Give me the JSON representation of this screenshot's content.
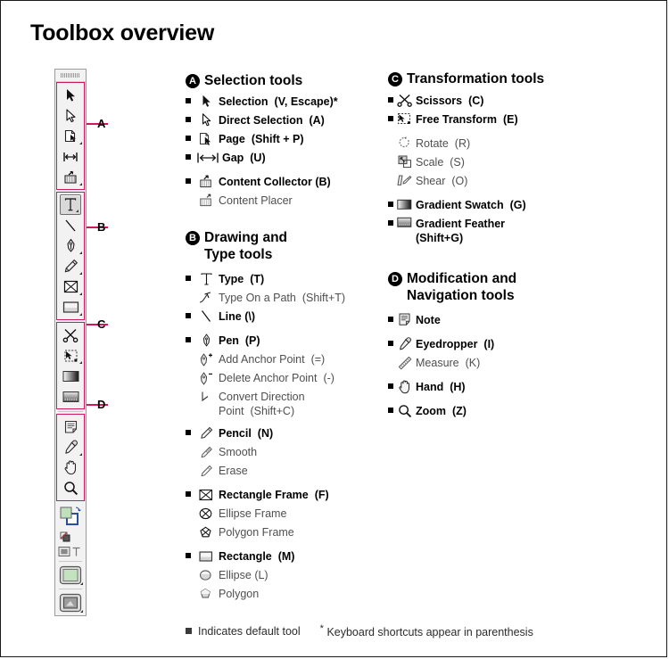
{
  "page": {
    "title": "Toolbox overview",
    "accent_color": "#d0165c",
    "dim_text_color": "#4f4f4f"
  },
  "callouts": [
    {
      "label": "A"
    },
    {
      "label": "B"
    },
    {
      "label": "C"
    },
    {
      "label": "D"
    }
  ],
  "toolbox": {
    "groups": [
      {
        "callout": "A",
        "highlighted": true,
        "tools": [
          "selection-tool",
          "direct-selection-tool",
          "page-tool",
          "gap-tool",
          "content-collector-tool"
        ]
      },
      {
        "callout": "B",
        "highlighted": true,
        "tools": [
          "type-tool",
          "line-tool",
          "pen-tool",
          "pencil-tool",
          "rectangle-frame-tool",
          "rectangle-tool"
        ]
      },
      {
        "callout": "C",
        "highlighted": true,
        "tools": [
          "scissors-tool",
          "free-transform-tool",
          "gradient-swatch-tool",
          "gradient-feather-tool"
        ]
      },
      {
        "callout": "D",
        "highlighted": true,
        "tools": [
          "note-tool",
          "eyedropper-tool",
          "hand-tool",
          "zoom-tool"
        ]
      },
      {
        "callout": "",
        "highlighted": false,
        "tools": [
          "fill-stroke-swatches",
          "formatting-affects-container",
          "normal-view-mode",
          "preview-mode"
        ]
      }
    ]
  },
  "sections": [
    {
      "badge": "A",
      "title": "Selection tools",
      "items": [
        {
          "icon": "selection-icon",
          "default": true,
          "name": "Selection",
          "shortcut": "(V, Escape)*"
        },
        {
          "icon": "direct-selection-icon",
          "default": true,
          "name": "Direct Selection",
          "shortcut": "(A)"
        },
        {
          "icon": "page-icon",
          "default": true,
          "name": "Page",
          "shortcut": "(Shift + P)"
        },
        {
          "icon": "gap-icon",
          "default": true,
          "name": "Gap",
          "shortcut": "(U)"
        },
        {
          "icon": "content-collector-icon",
          "default": true,
          "name": "Content Collector",
          "shortcut": "(B)",
          "spaced": true
        },
        {
          "icon": "content-placer-icon",
          "default": false,
          "name": "Content Placer",
          "shortcut": ""
        }
      ]
    },
    {
      "badge": "B",
      "title": "Drawing and\nType tools",
      "items": [
        {
          "icon": "type-icon",
          "default": true,
          "name": "Type",
          "shortcut": "(T)"
        },
        {
          "icon": "type-on-path-icon",
          "default": false,
          "name": "Type On a Path",
          "shortcut": "(Shift+T)"
        },
        {
          "icon": "line-icon",
          "default": true,
          "name": "Line",
          "shortcut": "(\\)"
        },
        {
          "icon": "pen-icon",
          "default": true,
          "name": "Pen",
          "shortcut": "(P)",
          "spaced": true
        },
        {
          "icon": "add-anchor-point-icon",
          "default": false,
          "name": "Add Anchor Point",
          "shortcut": "(=)"
        },
        {
          "icon": "delete-anchor-point-icon",
          "default": false,
          "name": "Delete Anchor Point",
          "shortcut": "(-)"
        },
        {
          "icon": "convert-direction-point-icon",
          "default": false,
          "name": "Convert Direction\nPoint",
          "shortcut": "(Shift+C)"
        },
        {
          "icon": "pencil-icon",
          "default": true,
          "name": "Pencil",
          "shortcut": "(N)",
          "spaced": true
        },
        {
          "icon": "smooth-icon",
          "default": false,
          "name": "Smooth",
          "shortcut": ""
        },
        {
          "icon": "erase-icon",
          "default": false,
          "name": "Erase",
          "shortcut": ""
        },
        {
          "icon": "rectangle-frame-icon",
          "default": true,
          "name": "Rectangle Frame",
          "shortcut": "(F)",
          "spaced": true
        },
        {
          "icon": "ellipse-frame-icon",
          "default": false,
          "name": "Ellipse Frame",
          "shortcut": ""
        },
        {
          "icon": "polygon-frame-icon",
          "default": false,
          "name": "Polygon Frame",
          "shortcut": ""
        },
        {
          "icon": "rectangle-icon",
          "default": true,
          "name": "Rectangle",
          "shortcut": "(M)",
          "spaced": true
        },
        {
          "icon": "ellipse-icon",
          "default": false,
          "name": "Ellipse",
          "shortcut": "(L)"
        },
        {
          "icon": "polygon-icon",
          "default": false,
          "name": "Polygon",
          "shortcut": ""
        }
      ]
    },
    {
      "badge": "C",
      "title": "Transformation tools",
      "items": [
        {
          "icon": "scissors-icon",
          "default": true,
          "name": "Scissors",
          "shortcut": "(C)"
        },
        {
          "icon": "free-transform-icon",
          "default": true,
          "name": "Free Transform",
          "shortcut": "(E)"
        },
        {
          "icon": "rotate-icon",
          "default": false,
          "name": "Rotate",
          "shortcut": "(R)",
          "spaced": true
        },
        {
          "icon": "scale-icon",
          "default": false,
          "name": "Scale",
          "shortcut": "(S)"
        },
        {
          "icon": "shear-icon",
          "default": false,
          "name": "Shear",
          "shortcut": "(O)"
        },
        {
          "icon": "gradient-swatch-icon",
          "default": true,
          "name": "Gradient Swatch",
          "shortcut": "(G)",
          "spaced": true
        },
        {
          "icon": "gradient-feather-icon",
          "default": true,
          "name": "Gradient Feather\n(Shift+G)",
          "shortcut": ""
        }
      ]
    },
    {
      "badge": "D",
      "title": "Modification and\nNavigation tools",
      "items": [
        {
          "icon": "note-icon",
          "default": true,
          "name": "Note",
          "shortcut": ""
        },
        {
          "icon": "eyedropper-icon",
          "default": true,
          "name": "Eyedropper",
          "shortcut": "(I)",
          "spaced": true
        },
        {
          "icon": "measure-icon",
          "default": false,
          "name": "Measure",
          "shortcut": "(K)"
        },
        {
          "icon": "hand-icon",
          "default": true,
          "name": "Hand",
          "shortcut": "(H)",
          "spaced": true
        },
        {
          "icon": "zoom-icon",
          "default": true,
          "name": "Zoom",
          "shortcut": "(Z)",
          "spaced": true
        }
      ]
    }
  ],
  "legend": {
    "default_tool_text": "Indicates default tool",
    "shortcut_note": "Keyboard shortcuts appear in parenthesis",
    "asterisk": "*"
  }
}
